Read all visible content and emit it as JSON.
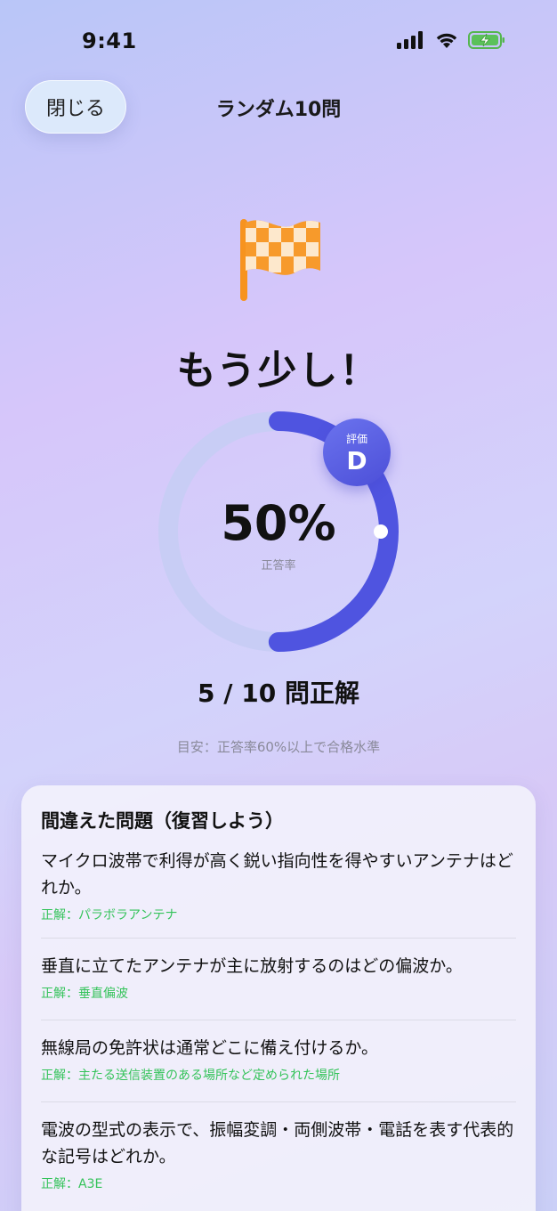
{
  "status_bar": {
    "time": "9:41"
  },
  "nav": {
    "close_label": "閉じる",
    "title": "ランダム10問"
  },
  "result": {
    "headline": "もう少し！",
    "percent": "50%",
    "percent_label": "正答率",
    "progress_fraction": 0.5,
    "grade_label": "評価",
    "grade": "D",
    "score_text": "5 / 10 問正解",
    "hint": "目安：正答率60%以上で合格水準"
  },
  "colors": {
    "accent": "#4f54e0",
    "correct": "#34c35a",
    "flag": "#f7931e"
  },
  "review": {
    "title": "間違えた問題（復習しよう）",
    "items": [
      {
        "question": "マイクロ波帯で利得が高く鋭い指向性を得やすいアンテナはどれか。",
        "answer": "正解：パラボラアンテナ"
      },
      {
        "question": "垂直に立てたアンテナが主に放射するのはどの偏波か。",
        "answer": "正解：垂直偏波"
      },
      {
        "question": "無線局の免許状は通常どこに備え付けるか。",
        "answer": "正解：主たる送信装置のある場所など定められた場所"
      },
      {
        "question": "電波の型式の表示で、振幅変調・両側波帯・電話を表す代表的な記号はどれか。",
        "answer": "正解：A3E"
      }
    ]
  }
}
